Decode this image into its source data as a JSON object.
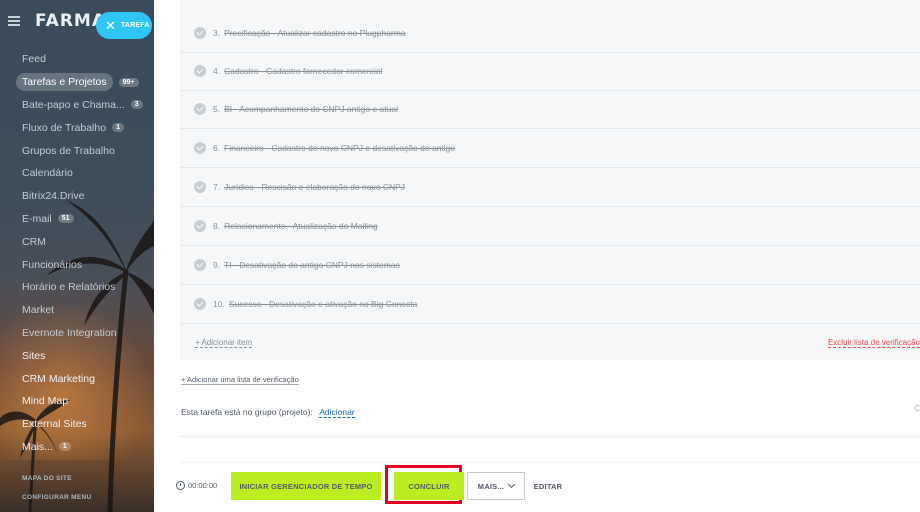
{
  "sidebar": {
    "logo": "FARMAR",
    "task_pill": "TAREFA",
    "items": [
      {
        "label": "Feed",
        "count": ""
      },
      {
        "label": "Tarefas e Projetos",
        "count": "99+"
      },
      {
        "label": "Bate-papo e Chama...",
        "count": "3"
      },
      {
        "label": "Fluxo de Trabalho",
        "count": "1"
      },
      {
        "label": "Grupos de Trabalho",
        "count": ""
      },
      {
        "label": "Calendário",
        "count": ""
      },
      {
        "label": "Bitrix24.Drive",
        "count": ""
      },
      {
        "label": "E-mail",
        "count": "51"
      },
      {
        "label": "CRM",
        "count": ""
      },
      {
        "label": "Funcionários",
        "count": ""
      },
      {
        "label": "Horário e Relatórios",
        "count": ""
      },
      {
        "label": "Market",
        "count": ""
      },
      {
        "label": "Evernote Integration",
        "count": ""
      },
      {
        "label": "Sites",
        "count": ""
      },
      {
        "label": "CRM Marketing",
        "count": ""
      },
      {
        "label": "Mind Map",
        "count": ""
      },
      {
        "label": "External Sites",
        "count": ""
      },
      {
        "label": "Mais...",
        "count": "1"
      }
    ],
    "footer_sitemap": "MAPA DO SITE",
    "footer_config": "CONFIGURAR MENU"
  },
  "checklist": {
    "items": [
      {
        "num": "3.",
        "text": "Precificação - Atualizar cadastro no Plugpharma"
      },
      {
        "num": "4.",
        "text": "Cadastro - Cadastro fornecedor comercial"
      },
      {
        "num": "5.",
        "text": "BI - Acompanhamento do CNPJ antigo e atual"
      },
      {
        "num": "6.",
        "text": "Financeiro - Cadastro do novo CNPJ e desativação do antigo"
      },
      {
        "num": "7.",
        "text": "Jurídico - Rescisão e elaboração do novo CNPJ"
      },
      {
        "num": "8.",
        "text": "Relacionamento - Atualização do Mailing"
      },
      {
        "num": "9.",
        "text": "TI - Desativação do antigo CNPJ nos sistemas"
      },
      {
        "num": "10.",
        "text": "Sucesso - Desativação e ativação no Big Conecta"
      }
    ],
    "add_item": "+ Adicionar item",
    "delete_list": "Excluir lista de verificação"
  },
  "task": {
    "add_checklist": "+ Adicionar uma lista de verificação",
    "group_label": "Esta tarefa está no grupo (projeto):",
    "group_link": "Adicionar",
    "side_text": "C"
  },
  "footer": {
    "timer": "00:00:00",
    "start_timer": "INICIAR GERENCIADOR DE TEMPO",
    "complete": "CONCLUIR",
    "more": "MAIS...",
    "edit": "EDITAR"
  },
  "colors": {
    "accent_green": "#bbed21",
    "highlight_red": "#e0051e",
    "pill_blue": "#2fc6f6"
  }
}
